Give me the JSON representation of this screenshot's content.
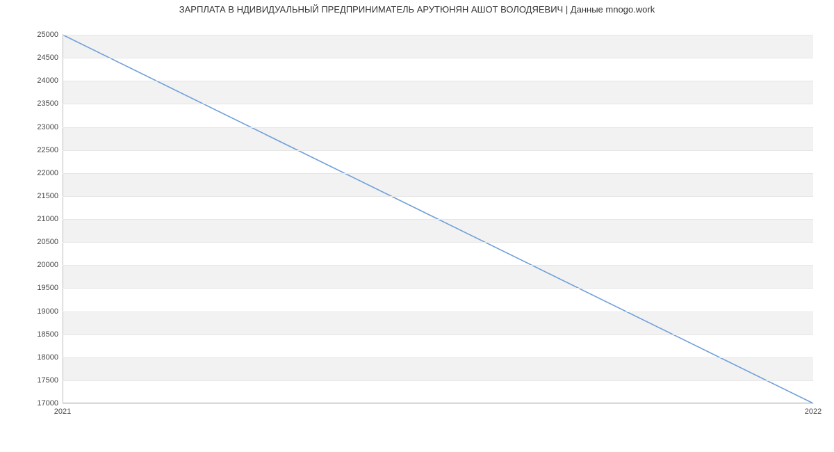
{
  "chart_data": {
    "type": "line",
    "title": "ЗАРПЛАТА В НДИВИДУАЛЬНЫЙ ПРЕДПРИНИМАТЕЛЬ АРУТЮНЯН АШОТ ВОЛОДЯЕВИЧ | Данные mnogo.work",
    "x": [
      2021,
      2022
    ],
    "y": [
      25000,
      17000
    ],
    "x_ticks": [
      2021,
      2022
    ],
    "y_ticks": [
      17000,
      17500,
      18000,
      18500,
      19000,
      19500,
      20000,
      20500,
      21000,
      21500,
      22000,
      22500,
      23000,
      23500,
      24000,
      24500,
      25000
    ],
    "xlim": [
      2021,
      2022
    ],
    "ylim": [
      17000,
      25000
    ],
    "xlabel": "",
    "ylabel": "",
    "line_color": "#6f9fd8"
  }
}
